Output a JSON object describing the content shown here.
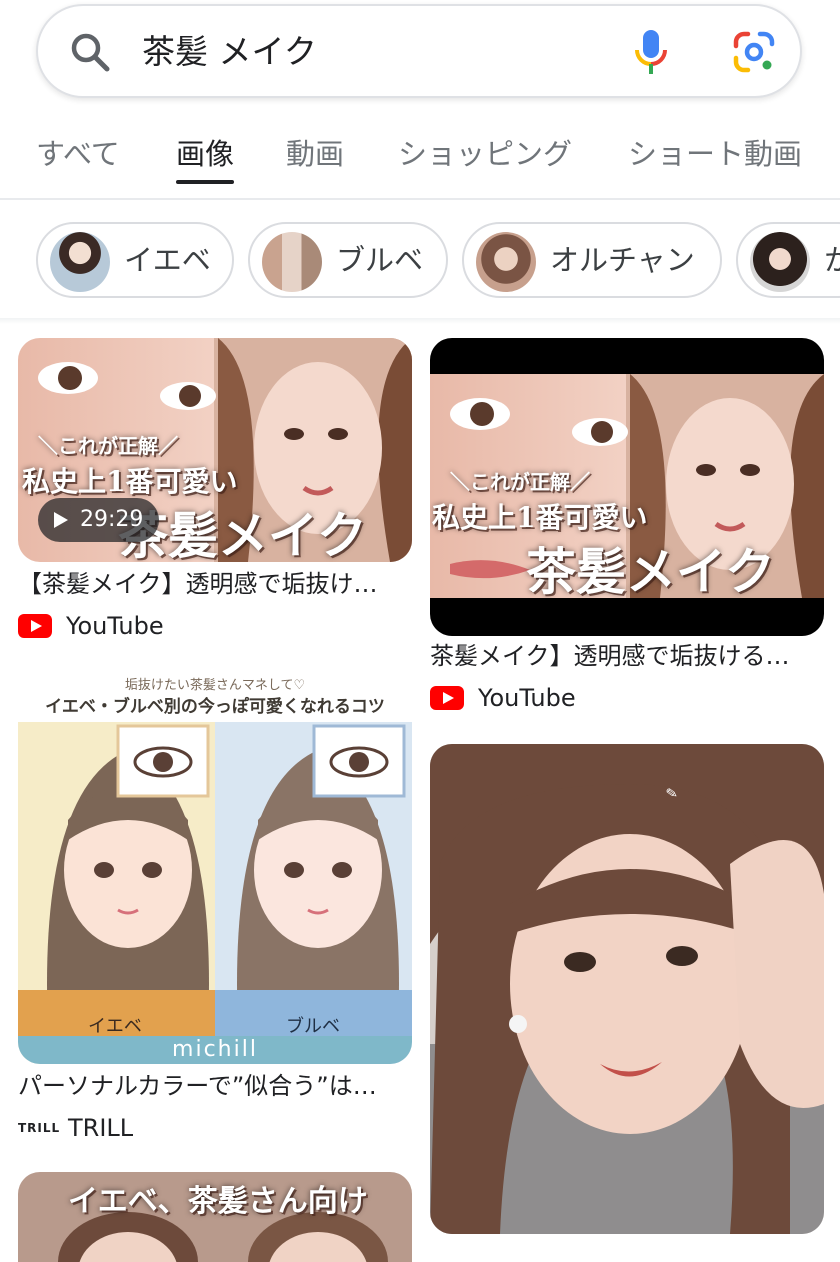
{
  "search": {
    "query": "茶髪 メイク"
  },
  "icons": {
    "search": "search-icon",
    "mic": "mic-icon",
    "lens": "google-lens-icon",
    "youtube": "youtube-icon"
  },
  "tabs": [
    {
      "label": "すべて",
      "active": false
    },
    {
      "label": "画像",
      "active": true
    },
    {
      "label": "動画",
      "active": false
    },
    {
      "label": "ショッピング",
      "active": false
    },
    {
      "label": "ショート動画",
      "active": false
    }
  ],
  "chips": [
    {
      "label": "イエベ"
    },
    {
      "label": "ブルベ"
    },
    {
      "label": "オルチャン"
    },
    {
      "label": "か"
    }
  ],
  "results": [
    {
      "title": "【茶髪メイク】透明感で垢抜け…",
      "source": "YouTube",
      "duration": "29:29",
      "overlay": {
        "line1": "＼これが正解／",
        "line2": "私史上1番可愛い",
        "line3": "茶髪メイク"
      }
    },
    {
      "title": "茶髪メイク】透明感で垢抜ける…",
      "source": "YouTube",
      "overlay": {
        "line1": "＼これが正解／",
        "line2": "私史上1番可愛い",
        "line3": "茶髪メイク"
      }
    },
    {
      "title": "パーソナルカラーで”似合う”は…",
      "source": "TRILL",
      "source_logo": "TRILL",
      "overlay": {
        "header_small": "垢抜けたい茶髪さんマネして♡",
        "header_big": "イエベ・ブルベ別の今っぽ可愛くなれるコツ",
        "left_label": "イエベ",
        "right_label": "ブルベ",
        "brand": "michill"
      }
    },
    {
      "title": "",
      "source": "",
      "overlay": {
        "line1": "イエベ、茶髪さん向け"
      }
    }
  ],
  "colors": {
    "youtube_red": "#ff0000",
    "tab_active": "#202124",
    "tab_inactive": "#70757a",
    "mic_blue": "#4285f4",
    "mic_red": "#ea4335",
    "mic_yellow": "#fbbc05",
    "mic_green": "#34a853"
  }
}
